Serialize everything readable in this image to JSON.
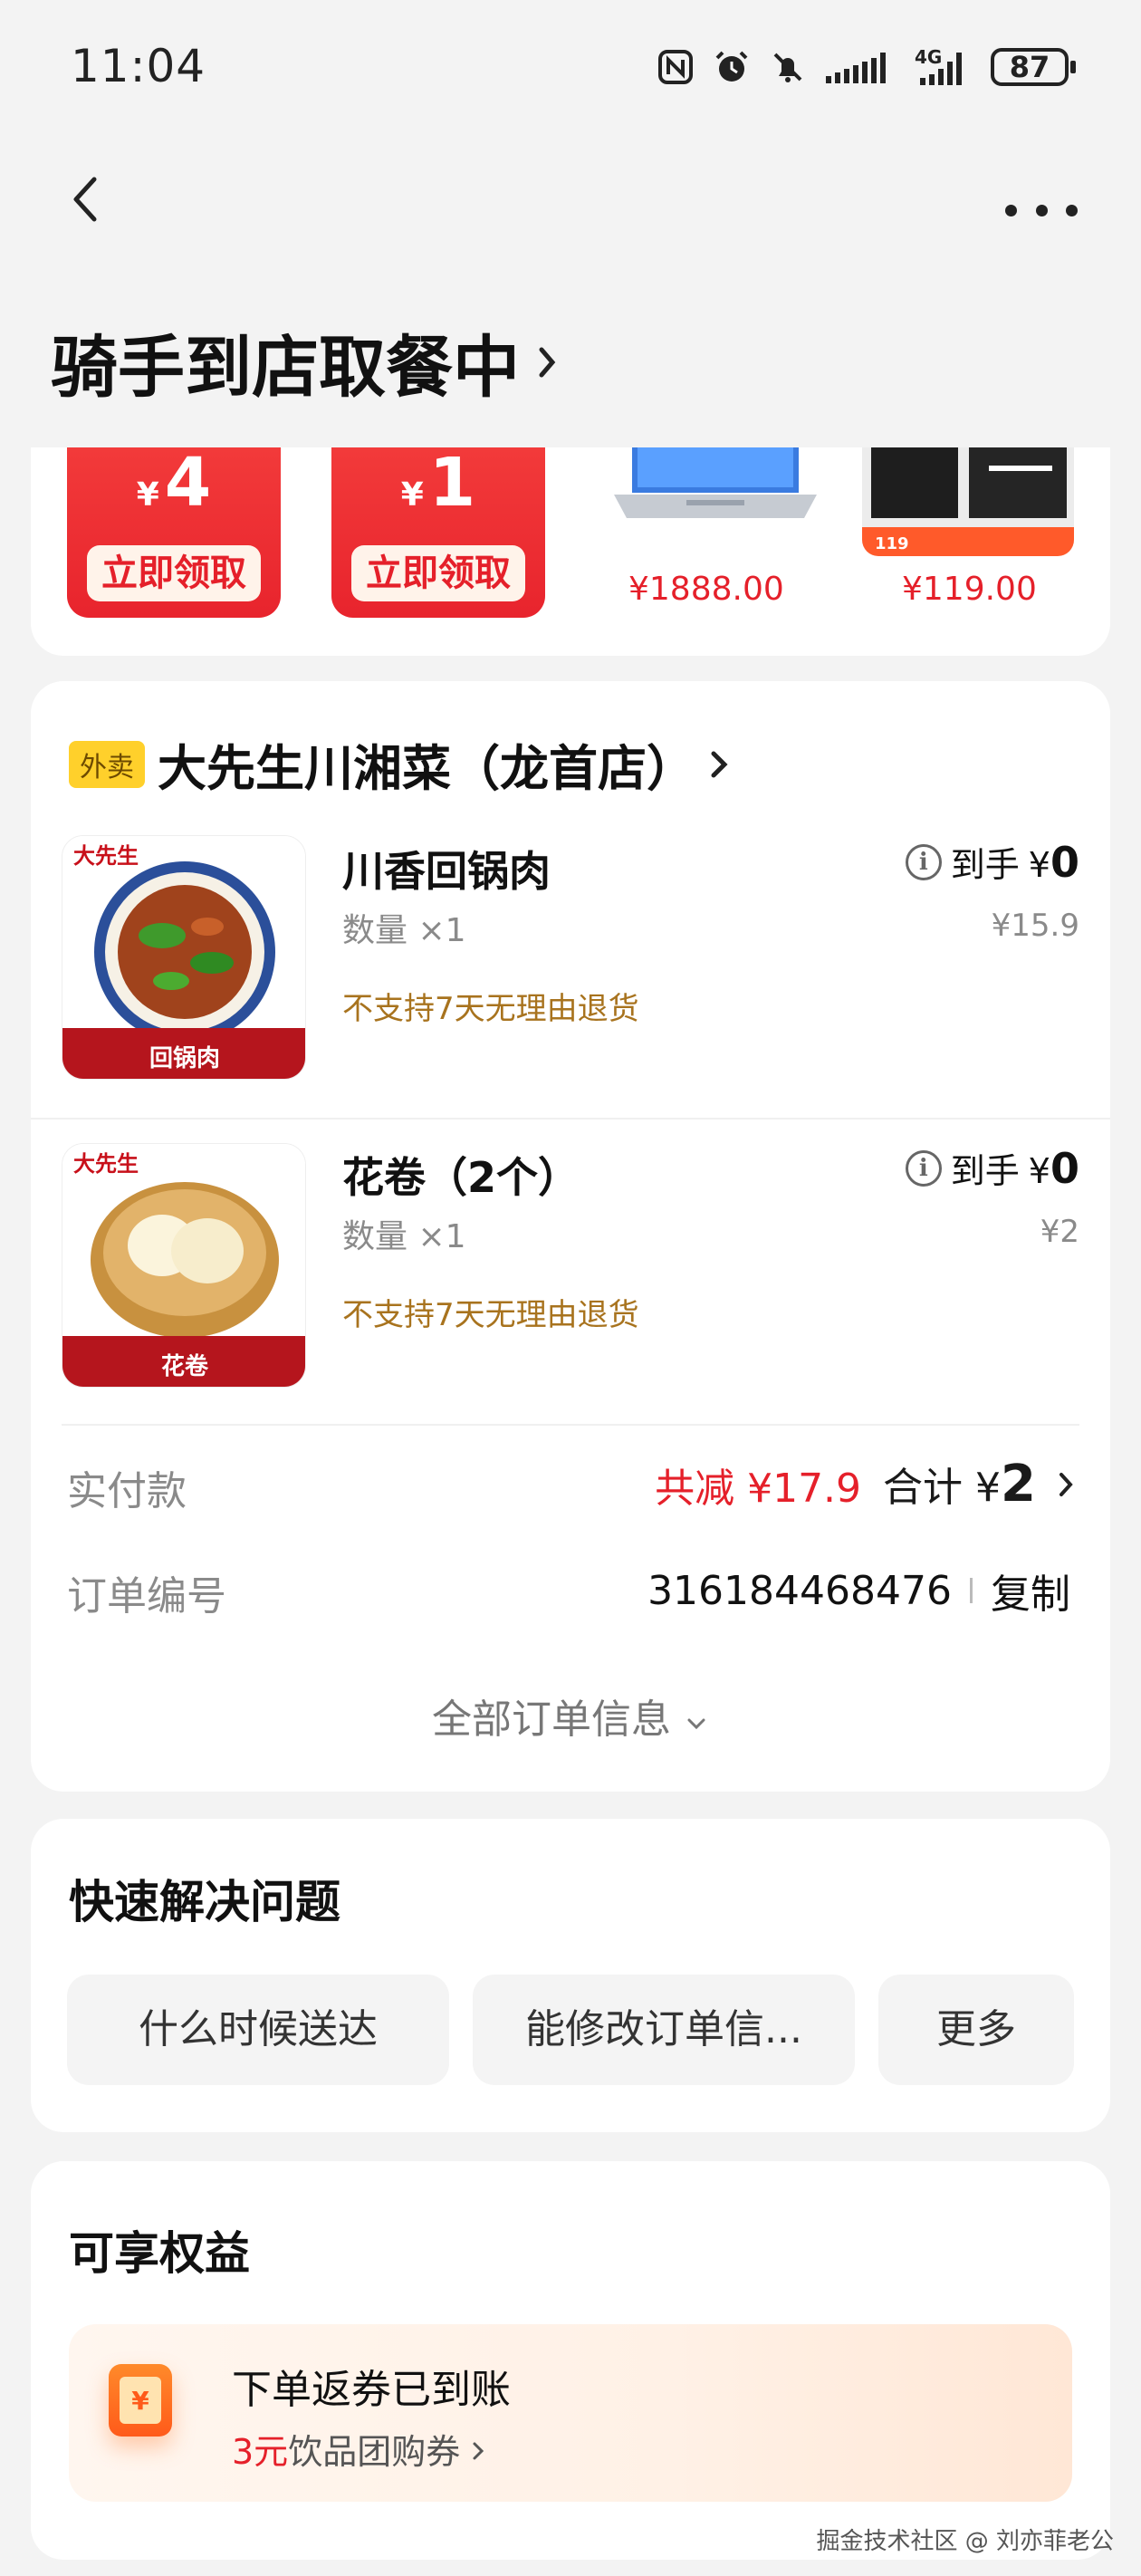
{
  "status_bar": {
    "time": "11:04",
    "battery": "87",
    "network": "4G",
    "icons": [
      "nfc-icon",
      "alarm-icon",
      "mute-icon",
      "signal-icon",
      "network-4g-icon",
      "battery-icon"
    ]
  },
  "nav": {
    "back_icon": "chevron-left-icon",
    "more_icon": "more-dots-icon"
  },
  "page_title": "骑手到店取餐中",
  "promo": {
    "coupons": [
      {
        "currency": "¥",
        "amount": "4",
        "button": "立即领取"
      },
      {
        "currency": "¥",
        "amount": "1",
        "button": "立即领取"
      }
    ],
    "products": [
      {
        "price": "¥1888.00",
        "image": "laptop"
      },
      {
        "price": "¥119.00",
        "image": "sports-shorts"
      }
    ]
  },
  "order": {
    "shop_tag": "外卖",
    "shop_name": "大先生川湘菜（龙首店）",
    "items": [
      {
        "name": "川香回锅肉",
        "qty_label": "数量",
        "qty": "×1",
        "policy": "不支持7天无理由退货",
        "final_label": "到手",
        "final_currency": "¥",
        "final_amount": "0",
        "original": "¥15.9",
        "image_caption": "回锅肉",
        "brand": "大先生"
      },
      {
        "name": "花卷（2个）",
        "qty_label": "数量",
        "qty": "×1",
        "policy": "不支持7天无理由退货",
        "final_label": "到手",
        "final_currency": "¥",
        "final_amount": "0",
        "original": "¥2",
        "image_caption": "花卷",
        "brand": "大先生"
      }
    ],
    "paid_label": "实付款",
    "discount_label": "共减 ¥17.9",
    "total_label": "合计 ¥",
    "total_amount": "2",
    "order_no_label": "订单编号",
    "order_no": "316184468476",
    "copy_label": "复制",
    "all_info_label": "全部订单信息"
  },
  "quick": {
    "title": "快速解决问题",
    "chips": [
      "什么时候送达",
      "能修改订单信...",
      "更多"
    ]
  },
  "benefits": {
    "title": "可享权益",
    "item_title": "下单返券已到账",
    "item_amount": "3元",
    "item_desc": "饮品团购券"
  },
  "watermark": "掘金技术社区 @ 刘亦菲老公",
  "colors": {
    "accent_red": "#e5202a",
    "policy_brown": "#a8731e",
    "tag_yellow": "#ffd02b",
    "background": "#f3f3f3"
  }
}
